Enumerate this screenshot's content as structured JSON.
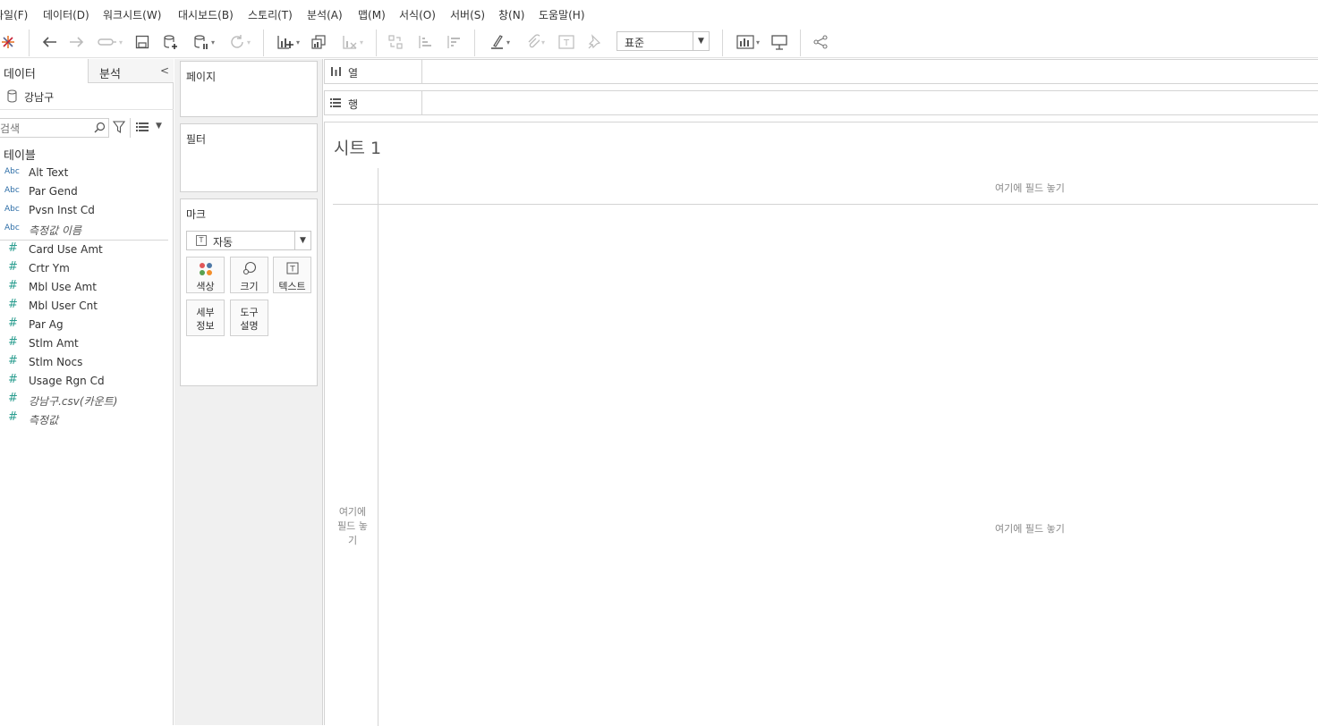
{
  "menu": [
    "파일(F)",
    "데이터(D)",
    "워크시트(W)",
    "대시보드(B)",
    "스토리(T)",
    "분석(A)",
    "맵(M)",
    "서식(O)",
    "서버(S)",
    "창(N)",
    "도움말(H)"
  ],
  "toolbar": {
    "fit_value": "표준"
  },
  "data_pane": {
    "tab_data": "데이터",
    "tab_analysis": "분석",
    "datasource": "강남구",
    "search_placeholder": "검색",
    "tables_title": "테이블",
    "dimension_type_label": "Abc",
    "dimensions": [
      {
        "name": "Alt Text"
      },
      {
        "name": "Par Gend"
      },
      {
        "name": "Pvsn Inst Cd"
      },
      {
        "name": "측정값 이름"
      }
    ],
    "measures": [
      {
        "name": "Card Use Amt"
      },
      {
        "name": "Crtr Ym"
      },
      {
        "name": "Mbl Use Amt"
      },
      {
        "name": "Mbl User Cnt"
      },
      {
        "name": "Par Ag"
      },
      {
        "name": "Stlm Amt"
      },
      {
        "name": "Stlm Nocs"
      },
      {
        "name": "Usage Rgn Cd"
      },
      {
        "name": "강남구.csv(카운트)"
      },
      {
        "name": "측정값"
      }
    ]
  },
  "cards": {
    "pages": "페이지",
    "filters": "필터",
    "marks": "마크",
    "marks_type": "자동",
    "color": "색상",
    "size": "크기",
    "text": "텍스트",
    "detail": "세부\n정보",
    "tooltip": "도구\n설명"
  },
  "shelves": {
    "columns": "열",
    "rows": "행"
  },
  "view": {
    "sheet_title": "시트 1",
    "drop_columns": "여기에 필드 놓기",
    "drop_rows": "여기에 필드 놓기",
    "drop_center": "여기에 필드 놓기"
  }
}
